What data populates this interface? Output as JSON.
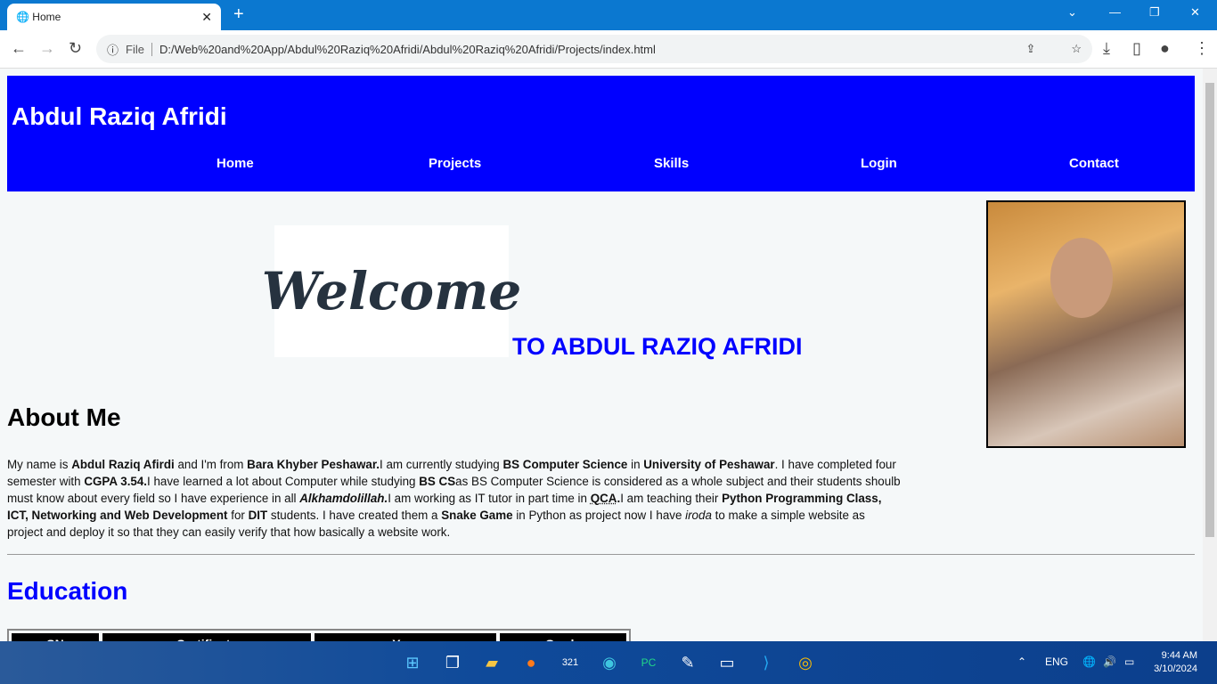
{
  "browser": {
    "tab_title": "Home",
    "file_label": "File",
    "url": "D:/Web%20and%20App/Abdul%20Raziq%20Afridi/Abdul%20Raziq%20Afridi/Projects/index.html"
  },
  "site": {
    "title": "Abdul Raziq Afridi",
    "nav": [
      "Home",
      "Projects",
      "Skills",
      "Login",
      "Contact"
    ],
    "welcome_image_text": "Welcome",
    "welcome_heading": "TO ABDUL RAZIQ AFRIDI",
    "about_heading": "About Me",
    "education_heading": "Education",
    "table_headers": [
      "SN",
      "Certificate",
      "Year",
      "Grade"
    ],
    "header_color": "#0000ff"
  },
  "taskbar": {
    "lang": "ENG",
    "time": "9:44 AM",
    "date": "3/10/2024"
  }
}
